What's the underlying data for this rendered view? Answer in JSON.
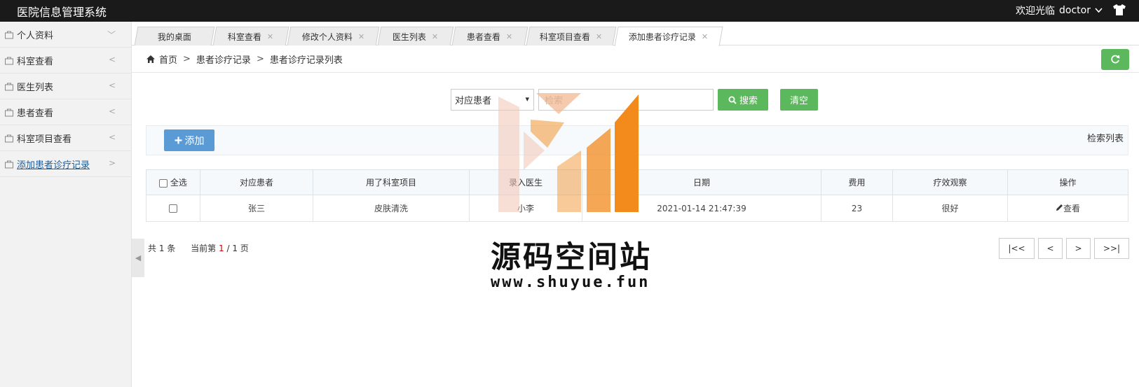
{
  "app": {
    "title": "医院信息管理系统",
    "welcome": "欢迎光临",
    "username": "doctor"
  },
  "sidebar": {
    "items": [
      {
        "label": "个人资料",
        "arrow": "﹀"
      },
      {
        "label": "科室查看",
        "arrow": "<"
      },
      {
        "label": "医生列表",
        "arrow": "<"
      },
      {
        "label": "患者查看",
        "arrow": "<"
      },
      {
        "label": "科室项目查看",
        "arrow": "<"
      },
      {
        "label": "添加患者诊疗记录",
        "arrow": ">"
      }
    ]
  },
  "tabs": [
    {
      "label": "我的桌面"
    },
    {
      "label": "科室查看"
    },
    {
      "label": "修改个人资料"
    },
    {
      "label": "医生列表"
    },
    {
      "label": "患者查看"
    },
    {
      "label": "科室项目查看"
    },
    {
      "label": "添加患者诊疗记录"
    }
  ],
  "breadcrumb": {
    "home": "首页",
    "level1": "患者诊疗记录",
    "level2": "患者诊疗记录列表"
  },
  "search": {
    "field": "对应患者",
    "placeholder": "检索",
    "search_label": "搜索",
    "clear_label": "清空"
  },
  "toolbar": {
    "add_label": "添加",
    "right_label": "检索列表"
  },
  "table": {
    "headers": {
      "select_all": "全选",
      "patient": "对应患者",
      "item": "用了科室项目",
      "recorder": "录入医生",
      "date": "日期",
      "fee": "费用",
      "effect": "疗效观察",
      "action": "操作"
    },
    "rows": [
      {
        "patient": "张三",
        "item": "皮肤清洗",
        "recorder": "小李",
        "date": "2021-01-14 21:47:39",
        "fee": "23",
        "effect": "很好",
        "action": "查看"
      }
    ]
  },
  "pager": {
    "total_prefix": "共",
    "total": "1",
    "total_suffix": "条",
    "current_prefix": "当前第",
    "current": "1",
    "pages": "/ 1 页",
    "first": "|<<",
    "prev": "<",
    "next": ">",
    "last": ">>|"
  },
  "watermark": {
    "title": "源码空间站",
    "url": "www.shuyue.fun"
  },
  "colors": {
    "topbar": "#1a1a1a",
    "green": "#5cb85c",
    "blue": "#5b9bd5",
    "wm_orange": "#f28a1c"
  }
}
